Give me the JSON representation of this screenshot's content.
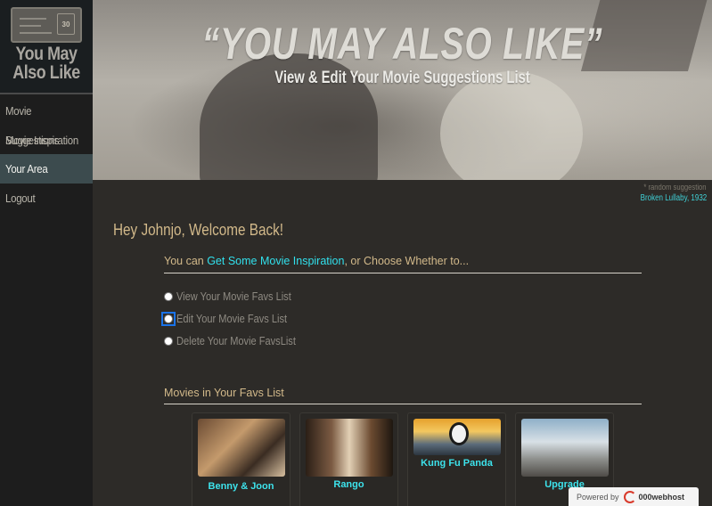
{
  "app": {
    "logo": {
      "line1": "You May",
      "line2": "Also Like",
      "ticket_number": "30",
      "ticket_label": "MOVIE TICKET"
    }
  },
  "sidebar": {
    "items": [
      {
        "label": "Movie Suggestions",
        "active": false
      },
      {
        "label": "Movie Inspiration",
        "active": false
      },
      {
        "label": "Your Area",
        "active": true
      },
      {
        "label": "Logout",
        "active": false
      }
    ]
  },
  "hero": {
    "title": "“YOU MAY ALSO LIKE”",
    "subtitle": "View & Edit Your Movie Suggestions List",
    "caption_note": "* random suggestion",
    "caption_link": "Broken Lullaby, 1932"
  },
  "main": {
    "welcome": "Hey Johnjo, Welcome Back!",
    "intro_prefix": "You can ",
    "intro_link": "Get Some Movie Inspiration",
    "intro_suffix": ", or Choose Whether to...",
    "options": [
      {
        "label": "View Your Movie Favs List",
        "checked": false
      },
      {
        "label": "Edit Your Movie Favs List",
        "checked": false
      },
      {
        "label": "Delete Your Movie FavsList",
        "checked": false
      }
    ],
    "favs_heading": "Movies in Your Favs List",
    "favs": [
      {
        "title": "Benny & Joon"
      },
      {
        "title": "Rango"
      },
      {
        "title": "Kung Fu Panda"
      },
      {
        "title": "Upgrade"
      }
    ]
  },
  "badge": {
    "powered_by": "Powered by",
    "brand": "000webhost"
  },
  "colors": {
    "accent": "#31e0ec",
    "heading": "#d2b98a",
    "nav_active": "#3c4b4e"
  }
}
